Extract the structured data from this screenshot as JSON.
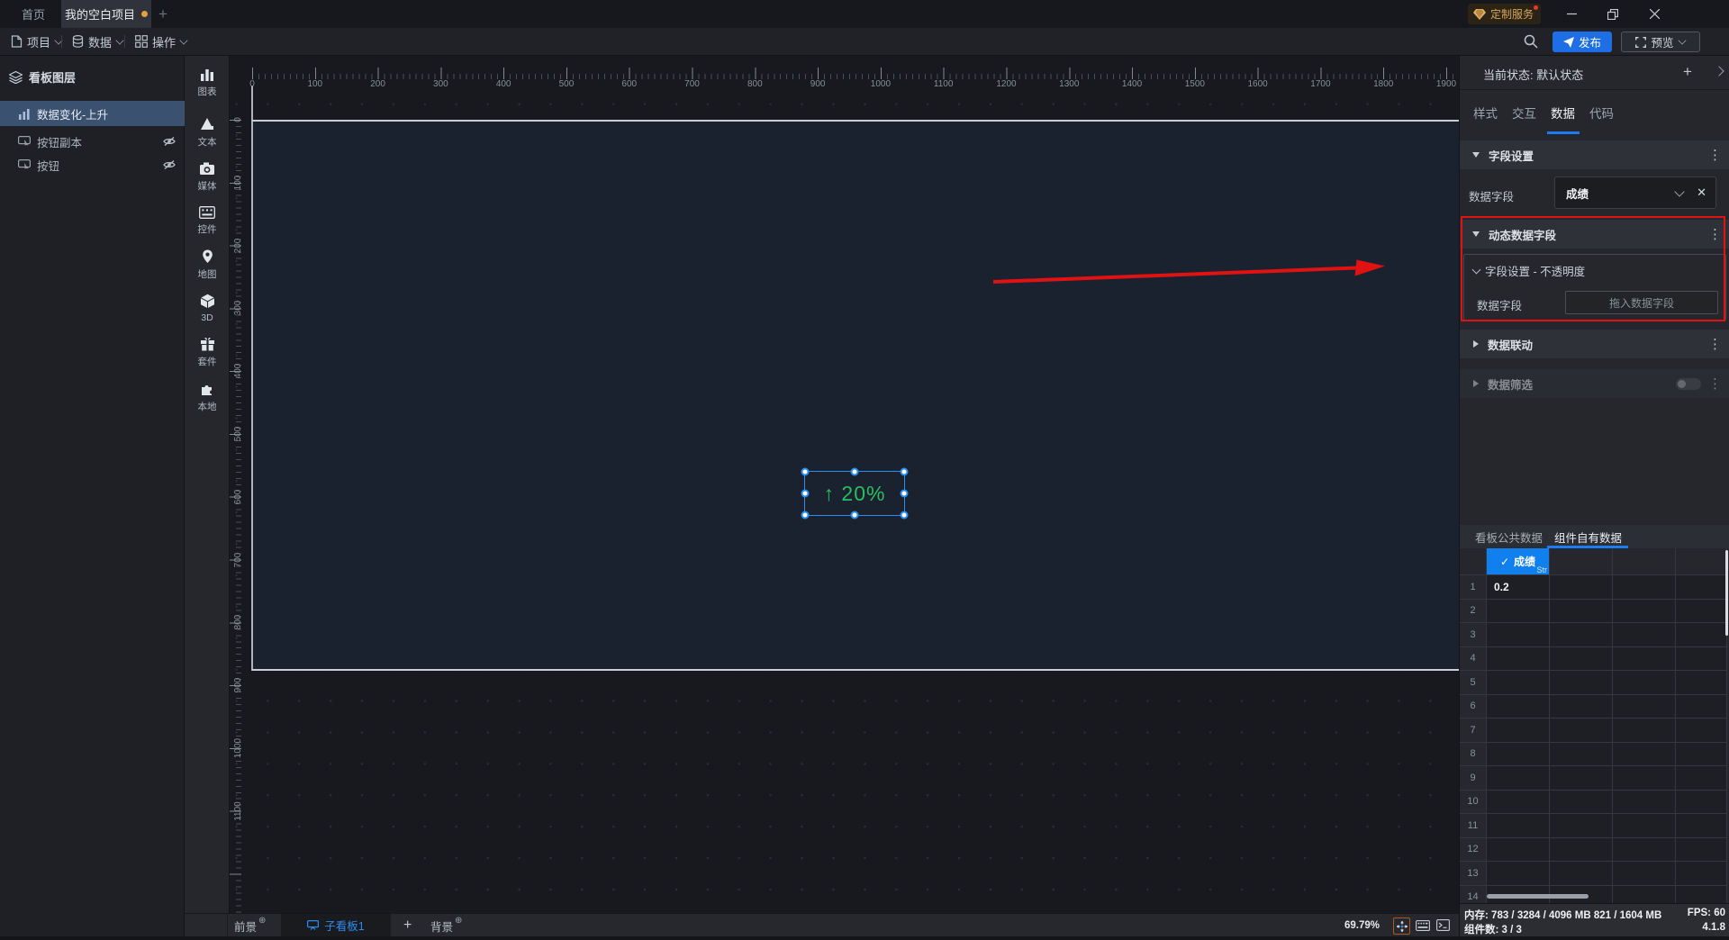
{
  "colors": {
    "accent_blue": "#1f7bf0",
    "selection_blue": "#2d8cf0",
    "green": "#2abf5e",
    "annotation_red": "#e01212",
    "tab_dot_orange": "#e5a23c",
    "badge_gold": "#d7a65c",
    "table_header_blue": "#1180ef"
  },
  "title_bar": {
    "home_tab": "首页",
    "project_tab": "我的空白项目",
    "new_tab": "+",
    "customize_badge": "定制服务",
    "minimize": "─",
    "restore": "❐",
    "close": "✕"
  },
  "menu_bar": {
    "project": "项目",
    "data": "数据",
    "action": "操作",
    "publish": "发布",
    "preview": "预览"
  },
  "layers_panel": {
    "header": "看板图层",
    "items": [
      {
        "label": "数据变化-上升"
      },
      {
        "label": "按钮副本"
      },
      {
        "label": "按钮"
      }
    ]
  },
  "component_toolbar": {
    "items": [
      {
        "label": "图表"
      },
      {
        "label": "文本"
      },
      {
        "label": "媒体"
      },
      {
        "label": "控件"
      },
      {
        "label": "地图"
      },
      {
        "label": "3D"
      },
      {
        "label": "套件"
      },
      {
        "label": "本地"
      }
    ]
  },
  "canvas": {
    "h_ruler": [
      "0",
      "100",
      "200",
      "300",
      "400",
      "500",
      "600",
      "700",
      "800",
      "900",
      "1000",
      "1100",
      "1200",
      "1300",
      "1400",
      "1500",
      "1600",
      "1700",
      "1800",
      "1900"
    ],
    "v_ruler": [
      "0",
      "100",
      "200",
      "300",
      "400",
      "500",
      "600",
      "700",
      "800",
      "900",
      "1000",
      "1100"
    ],
    "widget_text": "↑ 20%"
  },
  "bottom_bar": {
    "foreground": "前景",
    "board_tab": "子看板1",
    "add_tab": "+",
    "background": "背景",
    "zoom": "69.79%"
  },
  "right_panel": {
    "state_label": "当前状态: 默认状态",
    "tabs": [
      {
        "label": "样式"
      },
      {
        "label": "交互"
      },
      {
        "label": "数据"
      },
      {
        "label": "代码"
      }
    ],
    "field_settings": {
      "title": "字段设置",
      "field_label": "数据字段",
      "field_value": "成绩"
    },
    "dynamic_fields": {
      "title": "动态数据字段",
      "sub_title": "字段设置 - 不透明度",
      "field_label": "数据字段",
      "drop_placeholder": "拖入数据字段"
    },
    "data_linkage": {
      "title": "数据联动"
    },
    "data_filter": {
      "title": "数据筛选"
    },
    "data_tabs": [
      {
        "label": "看板公共数据"
      },
      {
        "label": "组件自有数据"
      }
    ],
    "table": {
      "column_header": "成绩",
      "column_type": "Str",
      "check": "✓",
      "rows": [
        {
          "n": "1",
          "v": "0.2"
        },
        {
          "n": "2",
          "v": ""
        },
        {
          "n": "3",
          "v": ""
        },
        {
          "n": "4",
          "v": ""
        },
        {
          "n": "5",
          "v": ""
        },
        {
          "n": "6",
          "v": ""
        },
        {
          "n": "7",
          "v": ""
        },
        {
          "n": "8",
          "v": ""
        },
        {
          "n": "9",
          "v": ""
        },
        {
          "n": "10",
          "v": ""
        },
        {
          "n": "11",
          "v": ""
        },
        {
          "n": "12",
          "v": ""
        },
        {
          "n": "13",
          "v": ""
        },
        {
          "n": "14",
          "v": ""
        }
      ]
    },
    "status": {
      "memory_label": "内存:",
      "memory_value": "783 / 3284 / 4096 MB  821 / 1604 MB",
      "fps_label": "FPS:",
      "fps_value": "60",
      "components_label": "组件数:",
      "components_value": "3 / 3",
      "version": "4.1.8"
    }
  }
}
